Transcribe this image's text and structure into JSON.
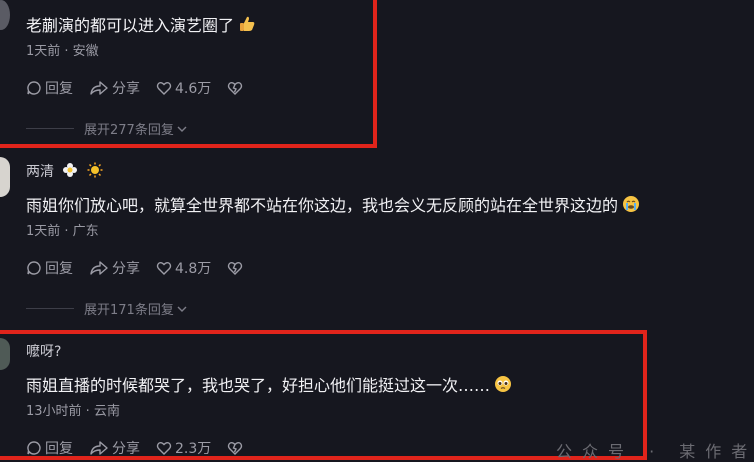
{
  "comments": [
    {
      "text": "老蒯演的都可以进入演艺圈了",
      "emoji": "thumbs-up",
      "meta": "1天前 · 安徽",
      "reply": "回复",
      "share": "分享",
      "likes": "4.6万",
      "expand": "展开277条回复"
    },
    {
      "name": "两清",
      "text": "雨姐你们放心吧，就算全世界都不站在你这边，我也会义无反顾的站在全世界这边的",
      "emoji": "crying-face",
      "meta": "1天前 · 广东",
      "reply": "回复",
      "share": "分享",
      "likes": "4.8万",
      "expand": "展开171条回复"
    },
    {
      "name": "嚒呀?",
      "text": "雨姐直播的时候都哭了，我也哭了，好担心他们能挺过这一次……",
      "emoji": "pleading-face",
      "meta": "13小时前 · 云南",
      "reply": "回复",
      "share": "分享",
      "likes": "2.3万"
    }
  ],
  "watermark": "公众号 · 某作者",
  "colors": {
    "background": "#16171f",
    "highlight_box": "#e0241b"
  }
}
